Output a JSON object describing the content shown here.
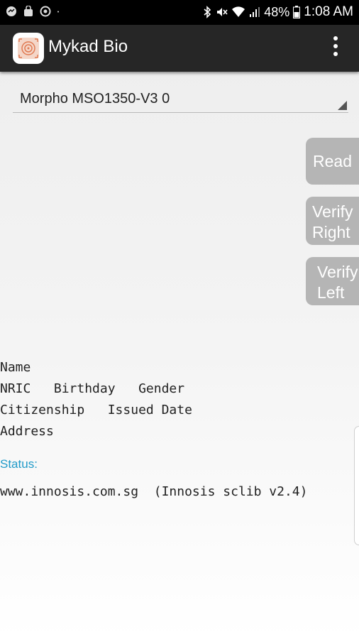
{
  "status_bar": {
    "battery": "48%",
    "time": "1:08 AM"
  },
  "app_bar": {
    "title": "Mykad Bio"
  },
  "spinner": {
    "selected": "Morpho MSO1350-V3 0"
  },
  "buttons": {
    "read": "Read",
    "verify_right": [
      "Verify",
      "Right"
    ],
    "verify_left": [
      "Verify",
      "Left"
    ]
  },
  "info": {
    "name": "Name",
    "nric_line": "NRIC   Birthday   Gender",
    "citizenship_line": "Citizenship   Issued Date",
    "address": "Address"
  },
  "status": {
    "label": "Status:",
    "footer": "www.innosis.com.sg  (Innosis sclib v2.4)"
  }
}
